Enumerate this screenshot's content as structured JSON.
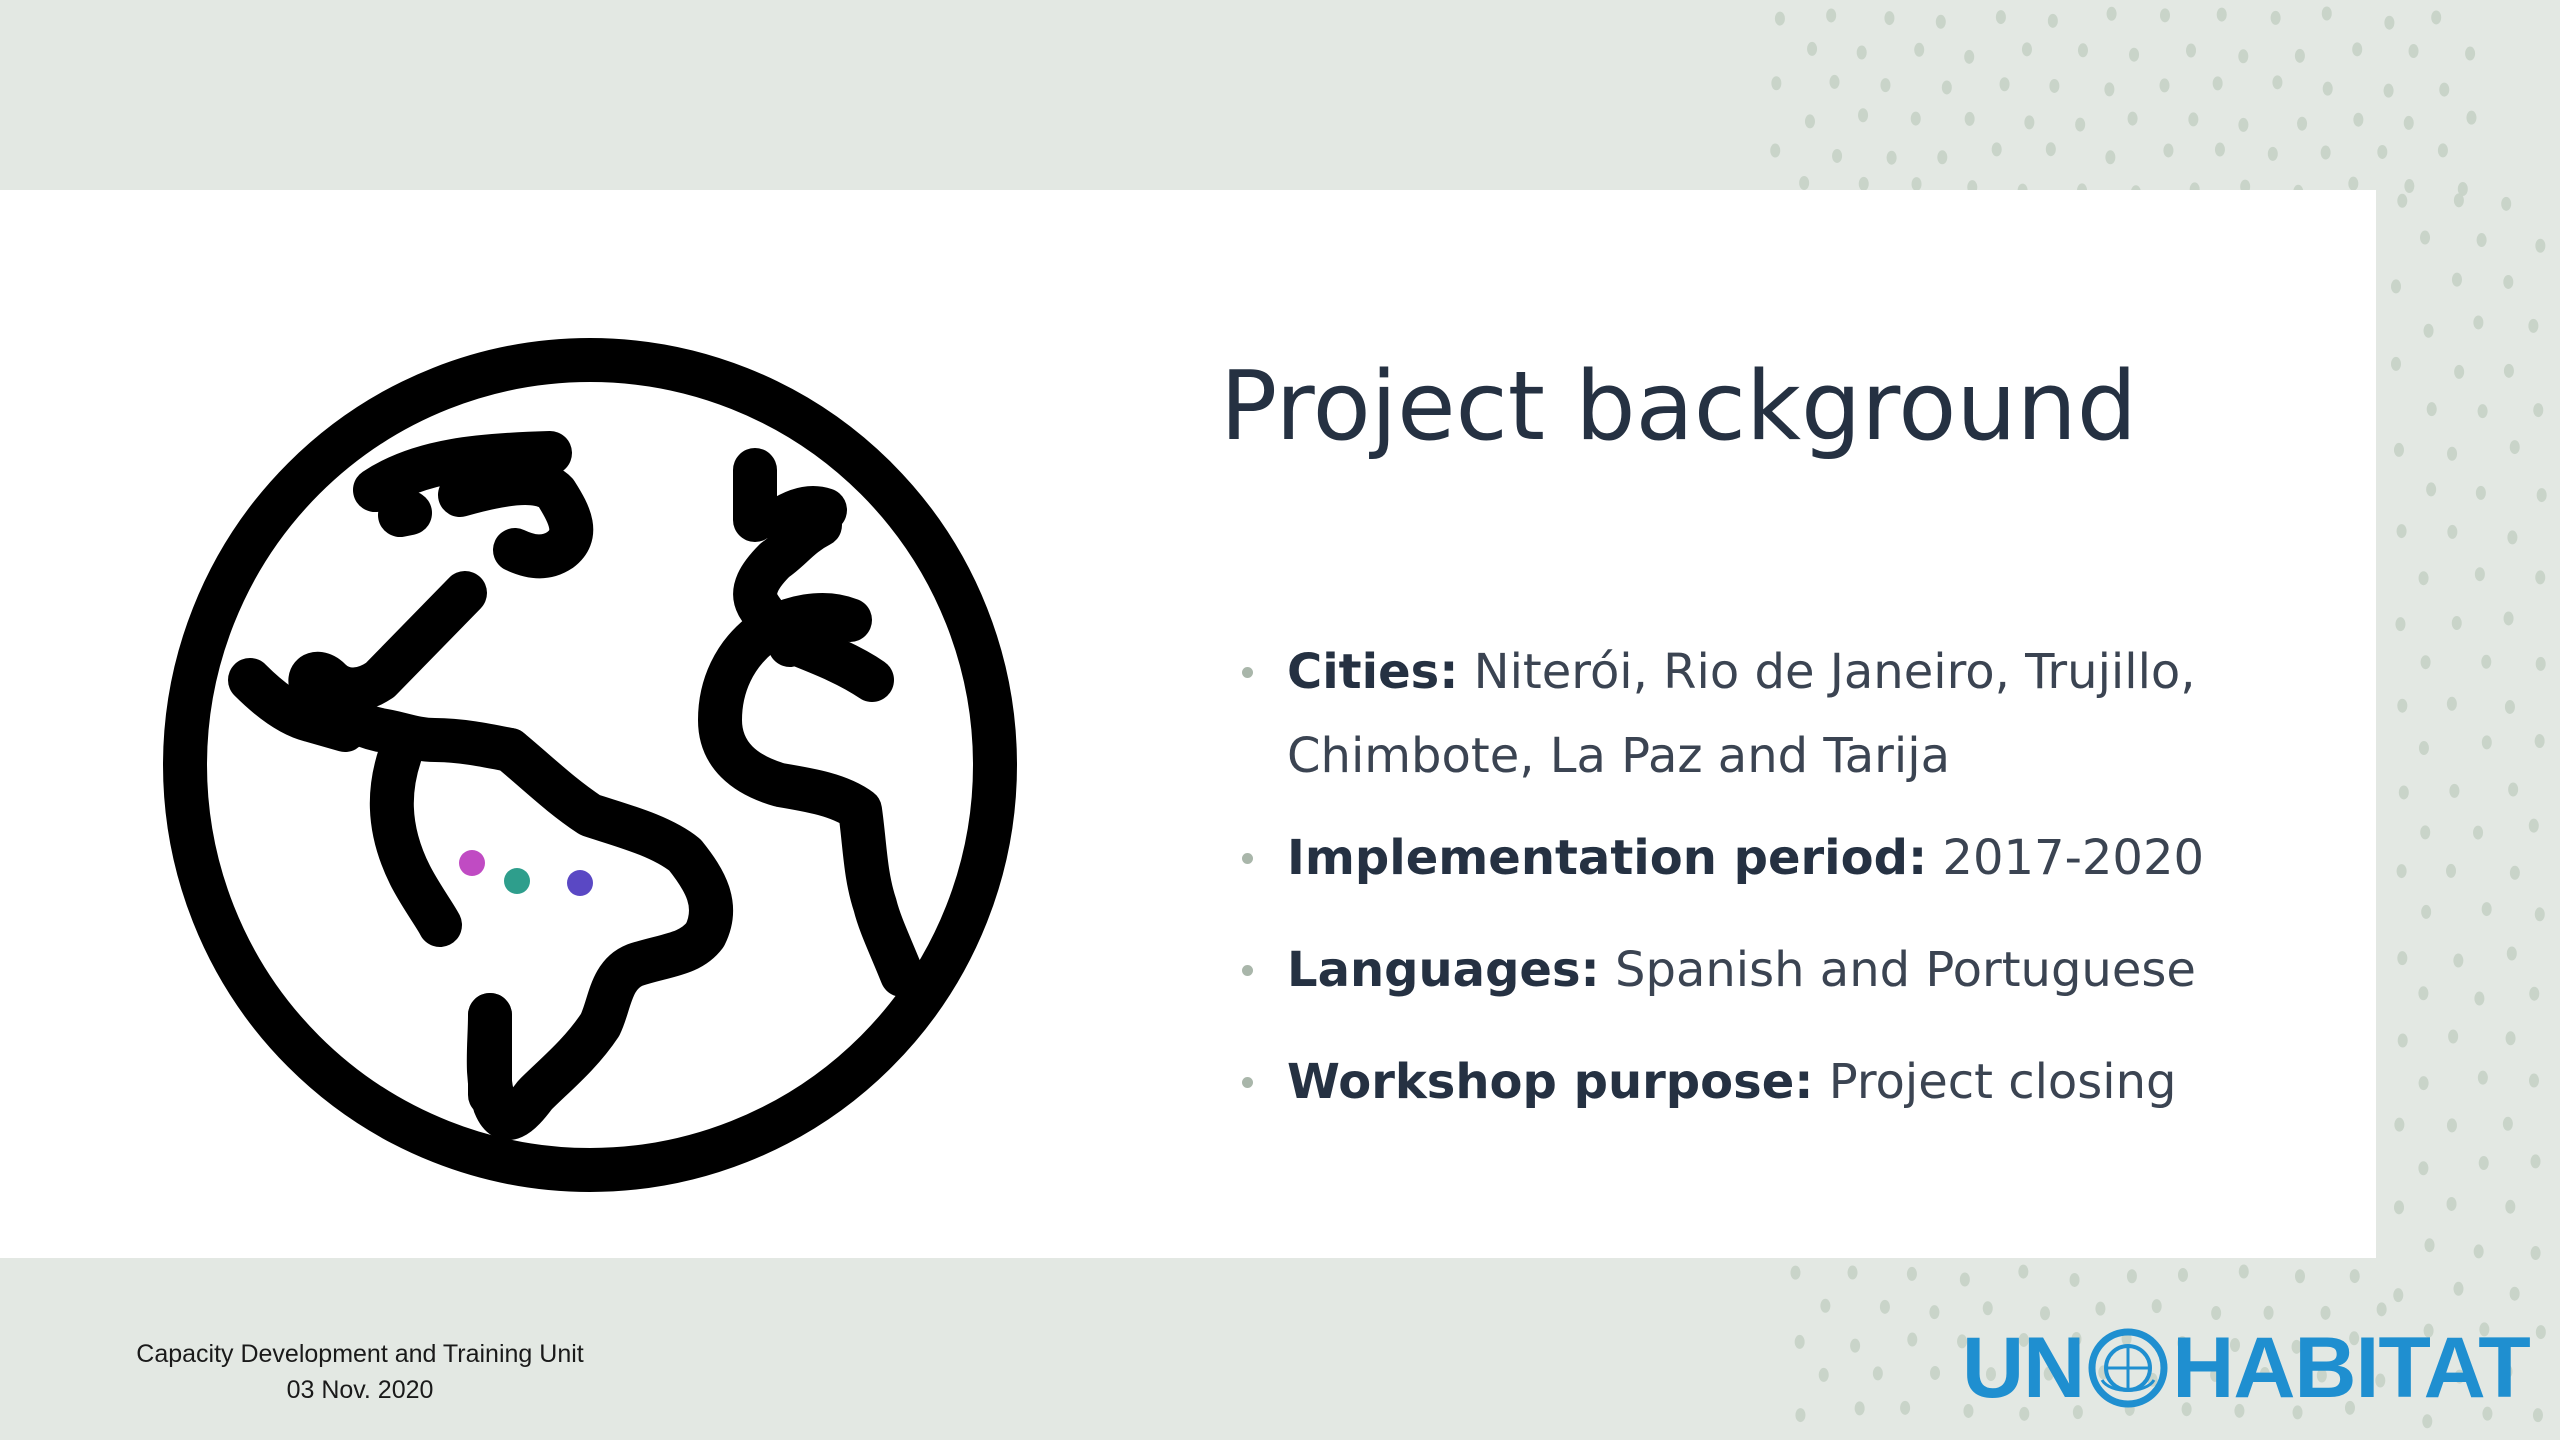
{
  "slide": {
    "title": "Project background",
    "bullets": [
      {
        "key": "Cities:",
        "value": " Niterói, Rio de Janeiro, Trujillo, Chimbote, La Paz and Tarija"
      },
      {
        "key": "Implementation period:",
        "value": " 2017-2020"
      },
      {
        "key": "Languages:",
        "value": " Spanish and Portuguese"
      },
      {
        "key": "Workshop purpose:",
        "value": " Project closing"
      }
    ]
  },
  "globe": {
    "icon": "globe-americas-icon",
    "markers": [
      {
        "color": "#c04bc3"
      },
      {
        "color": "#2e9e8c"
      },
      {
        "color": "#5a48c4"
      }
    ]
  },
  "footer": {
    "line1": "Capacity Development and Training Unit",
    "line2": "03 Nov. 2020"
  },
  "logo": {
    "left": "UN",
    "right": "HABITAT",
    "color": "#1f8fd0"
  },
  "colors": {
    "background": "#e3e8e3",
    "panel": "#ffffff",
    "title": "#253142",
    "bullet": "#a9b6aa"
  }
}
